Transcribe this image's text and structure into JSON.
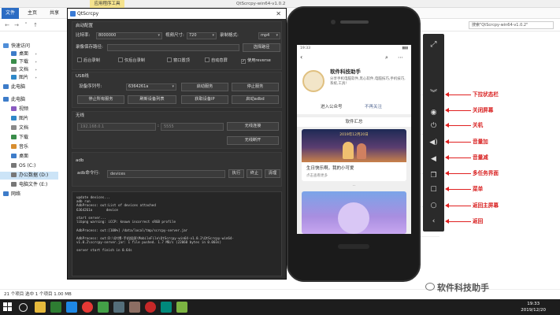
{
  "explorer": {
    "ribbon_tabs": [
      "文件",
      "主页",
      "共享"
    ],
    "context_tab": "应用程序工具",
    "title": "QtScrcpy-win64-v1.0.2",
    "search_placeholder": "搜索\"QtScrcpy-win64-v1.0.2\"",
    "sidebar": [
      {
        "label": "快速访问",
        "pin": false,
        "highlight": false
      },
      {
        "label": "桌面",
        "pin": true,
        "highlight": false
      },
      {
        "label": "下载",
        "pin": true,
        "highlight": false
      },
      {
        "label": "文档",
        "pin": true,
        "highlight": false
      },
      {
        "label": "图片",
        "pin": true,
        "highlight": false
      },
      {
        "label": "此电脑",
        "pin": false,
        "highlight": false
      },
      {
        "label": "此电脑",
        "pin": false,
        "highlight": false
      },
      {
        "label": "视频",
        "pin": false,
        "highlight": false
      },
      {
        "label": "图片",
        "pin": false,
        "highlight": false
      },
      {
        "label": "文档",
        "pin": false,
        "highlight": false
      },
      {
        "label": "下载",
        "pin": false,
        "highlight": false
      },
      {
        "label": "音乐",
        "pin": false,
        "highlight": false
      },
      {
        "label": "桌面",
        "pin": false,
        "highlight": false
      },
      {
        "label": "OS (C:)",
        "pin": false,
        "highlight": false
      },
      {
        "label": "办公数据 (D:)",
        "pin": false,
        "highlight": true
      },
      {
        "label": "电脑文件 (E:)",
        "pin": false,
        "highlight": false
      },
      {
        "label": "网络",
        "pin": false,
        "highlight": false
      }
    ],
    "status": "21 个项目    选中 1 个项目  1.00 MB"
  },
  "taskbar": {
    "time": "19:33",
    "date": "2019/12/20"
  },
  "qt": {
    "title": "QtScrcpy",
    "close": "✕",
    "config": {
      "header": "启动配置",
      "bitrate_label": "比特率:",
      "bitrate_value": "8000000",
      "resolution_label": "视频尺寸:",
      "resolution_value": "720",
      "record_format_label": "录制格式:",
      "record_format_value": "mp4",
      "save_path_label": "录像保存路径:",
      "select_path_button": "选择路径",
      "checkboxes": [
        {
          "label": "后台录制",
          "checked": false
        },
        {
          "label": "仅后台录制",
          "checked": false
        },
        {
          "label": "窗口置顶",
          "checked": false
        },
        {
          "label": "自动息屏",
          "checked": false
        },
        {
          "label": "使用reverse",
          "checked": true
        }
      ]
    },
    "usb": {
      "header": "USB线",
      "serial_label": "设备序列号:",
      "serial_value": "6364261a",
      "start_service": "启动服务",
      "stop_service": "停止服务",
      "stop_all": "停止所有服务",
      "refresh_devices": "刷新设备列表",
      "get_ip": "获取设备IP",
      "start_adbd": "启动adbd"
    },
    "wireless": {
      "header": "无线",
      "ip_placeholder": "192.168.0.1",
      "port_placeholder": "5555",
      "connect": "无线连接",
      "disconnect": "无线断开"
    },
    "adb": {
      "header": "adb",
      "cmd_label": "adb命令行:",
      "cmd_value": "devices",
      "execute": "执行",
      "terminate": "终止",
      "clear": "清理"
    },
    "log_lines": [
      "update devices...",
      "adb run",
      "AdbProcess: out:List of devices attached",
      "6364261a       device",
      "",
      "start server...",
      "libpng warning: iCCP: known incorrect sRGB profile",
      "",
      "AdbProcess: out:[100%] /data/local/tmp/scrcpy-server.jar",
      "",
      "AdbProcess: out:D:\\Qt博-手机投屏\\MobileFile\\QtScrcpy-win64-v1.0.2\\QtScrcpy-win64-",
      "v1.0.2\\scrcpy-server.jar: 1 file pushed. 1.7 MB/s (22060 bytes in 0.003s)",
      "",
      "server start finish in 0.64s"
    ]
  },
  "phone": {
    "status_time": "19:33",
    "account_name": "软件科技助手",
    "account_desc": "分享手机电脑软件,黑心软件,电脑技巧,手机技巧,系统,工具!",
    "enter_button": "进入公众号",
    "unfollow_button": "不再关注",
    "menu_header": "软件汇总",
    "card_date": "2019年12月20日",
    "card_caption": "生日快乐啊，我的小可爱",
    "card_link": "点击查看更多",
    "page_dot": "··"
  },
  "control_bar": {
    "icons": [
      "fullscreen-icon",
      "expand-down-icon",
      "eye-icon",
      "power-icon",
      "volume-up-icon",
      "volume-down-icon",
      "app-switch-icon",
      "menu-icon",
      "home-icon",
      "back-icon"
    ]
  },
  "annotations": [
    "下拉状态栏",
    "关闭屏幕",
    "关机",
    "音量加",
    "音量减",
    "多任务界面",
    "菜单",
    "返回主屏幕",
    "返回"
  ],
  "watermark": "软件科技助手",
  "colors": {
    "annotation_red": "#e02020",
    "dialog_bg": "#2f2f2f",
    "taskbar": "#1d1d1d",
    "control_bar": "#2a2a2a"
  }
}
